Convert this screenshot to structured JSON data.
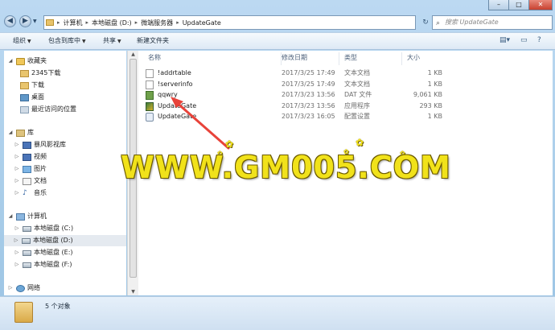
{
  "address": {
    "crumbs": [
      "计算机",
      "本地磁盘 (D:)",
      "微端服务器",
      "UpdateGate"
    ],
    "search_placeholder": "搜索 UpdateGate"
  },
  "toolbar": {
    "organize": "组织",
    "include_library": "包含到库中",
    "share": "共享",
    "new_folder": "新建文件夹"
  },
  "nav": {
    "favorites": "收藏夹",
    "fav_items": [
      "2345下载",
      "下载",
      "桌面",
      "最近访问的位置"
    ],
    "library": "库",
    "lib_items": [
      "暴风影视库",
      "视频",
      "图片",
      "文档",
      "音乐"
    ],
    "computer": "计算机",
    "drives": [
      "本地磁盘 (C:)",
      "本地磁盘 (D:)",
      "本地磁盘 (E:)",
      "本地磁盘 (F:)"
    ],
    "network": "网络"
  },
  "columns": {
    "name": "名称",
    "date": "修改日期",
    "type": "类型",
    "size": "大小"
  },
  "files": [
    {
      "name": "!addrtable",
      "date": "2017/3/25 17:49",
      "type": "文本文档",
      "size": "1 KB",
      "icon": "text-file-icon"
    },
    {
      "name": "!serverinfo",
      "date": "2017/3/25 17:49",
      "type": "文本文档",
      "size": "1 KB",
      "icon": "text-file-icon"
    },
    {
      "name": "qqwry",
      "date": "2017/3/23 13:56",
      "type": "DAT 文件",
      "size": "9,061 KB",
      "icon": "dat-file-icon"
    },
    {
      "name": "UpdateGate",
      "date": "2017/3/23 13:56",
      "type": "应用程序",
      "size": "293 KB",
      "icon": "app-icon"
    },
    {
      "name": "UpdateGate",
      "date": "2017/3/23 16:05",
      "type": "配置设置",
      "size": "1 KB",
      "icon": "config-file-icon"
    }
  ],
  "status": {
    "count_text": "5 个对象"
  },
  "watermark": "WWW.GM005.COM",
  "colors": {
    "annotation_arrow": "#e8433a",
    "watermark": "#f1e21a"
  }
}
